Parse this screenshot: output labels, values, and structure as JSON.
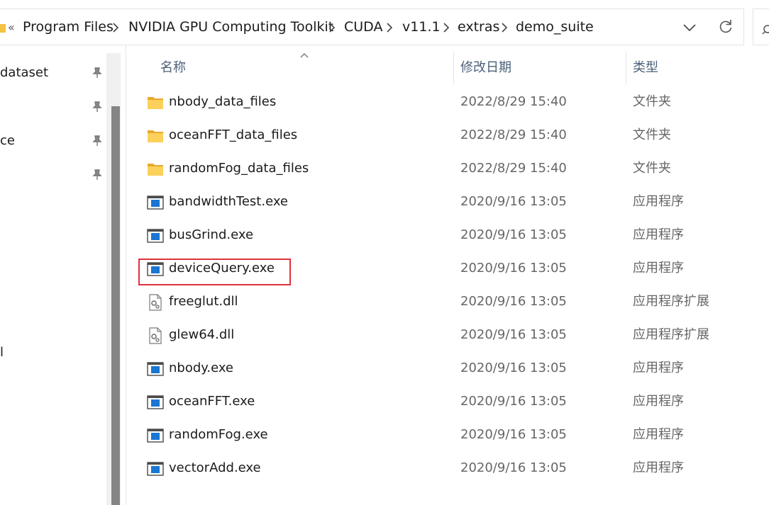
{
  "address_bar": {
    "overflow_glyph": "«",
    "separator": ">",
    "segments": [
      "Program Files",
      "NVIDIA GPU Computing Toolkit",
      "CUDA",
      "v11.1",
      "extras",
      "demo_suite"
    ],
    "folder_icon_color": "#f5c243"
  },
  "nav_pane": {
    "items": [
      {
        "label": "dataset",
        "pinned": true
      },
      {
        "label": "",
        "pinned": true
      },
      {
        "label": "ce",
        "pinned": true
      },
      {
        "label": "",
        "pinned": true
      },
      {
        "label": "l",
        "pinned": false
      }
    ]
  },
  "columns": {
    "name": "名称",
    "date_modified": "修改日期",
    "type": "类型",
    "sort_indicator": "^"
  },
  "files": [
    {
      "name": "nbody_data_files",
      "date": "2022/8/29 15:40",
      "type": "文件夹",
      "icon": "folder-icon"
    },
    {
      "name": "oceanFFT_data_files",
      "date": "2022/8/29 15:40",
      "type": "文件夹",
      "icon": "folder-icon"
    },
    {
      "name": "randomFog_data_files",
      "date": "2022/8/29 15:40",
      "type": "文件夹",
      "icon": "folder-icon"
    },
    {
      "name": "bandwidthTest.exe",
      "date": "2020/9/16 13:05",
      "type": "应用程序",
      "icon": "exe-icon"
    },
    {
      "name": "busGrind.exe",
      "date": "2020/9/16 13:05",
      "type": "应用程序",
      "icon": "exe-icon"
    },
    {
      "name": "deviceQuery.exe",
      "date": "2020/9/16 13:05",
      "type": "应用程序",
      "icon": "exe-icon"
    },
    {
      "name": "freeglut.dll",
      "date": "2020/9/16 13:05",
      "type": "应用程序扩展",
      "icon": "dll-icon"
    },
    {
      "name": "glew64.dll",
      "date": "2020/9/16 13:05",
      "type": "应用程序扩展",
      "icon": "dll-icon"
    },
    {
      "name": "nbody.exe",
      "date": "2020/9/16 13:05",
      "type": "应用程序",
      "icon": "exe-icon"
    },
    {
      "name": "oceanFFT.exe",
      "date": "2020/9/16 13:05",
      "type": "应用程序",
      "icon": "exe-icon"
    },
    {
      "name": "randomFog.exe",
      "date": "2020/9/16 13:05",
      "type": "应用程序",
      "icon": "exe-icon"
    },
    {
      "name": "vectorAdd.exe",
      "date": "2020/9/16 13:05",
      "type": "应用程序",
      "icon": "exe-icon"
    }
  ],
  "highlighted_file": "deviceQuery.exe",
  "colors": {
    "highlight": "#e0313a",
    "header_text": "#4c607a",
    "secondary_text": "#666666",
    "exe_blue": "#1976d2"
  }
}
